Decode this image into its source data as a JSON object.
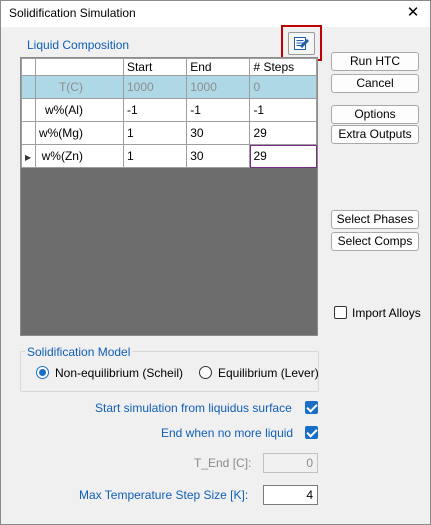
{
  "window": {
    "title": "Solidification Simulation",
    "close_label": "✕"
  },
  "liquid_composition": {
    "label": "Liquid Composition",
    "columns": [
      "",
      "Start",
      "End",
      "# Steps"
    ],
    "rows": [
      {
        "name": "T(C)",
        "start": "1000",
        "end": "1000",
        "steps": "0",
        "disabled": true
      },
      {
        "name": "w%(Al)",
        "start": "-1",
        "end": "-1",
        "steps": "-1"
      },
      {
        "name": "w%(Mg)",
        "start": "1",
        "end": "30",
        "steps": "29"
      },
      {
        "name": "w%(Zn)",
        "start": "1",
        "end": "30",
        "steps": "29",
        "current": true
      }
    ]
  },
  "buttons": {
    "run_htc": "Run HTC",
    "cancel": "Cancel",
    "options": "Options",
    "extra_outputs": "Extra Outputs",
    "select_phases": "Select Phases",
    "select_comps": "Select Comps"
  },
  "import_alloys": {
    "label": "Import Alloys",
    "checked": false
  },
  "solidification_model": {
    "label": "Solidification Model",
    "options": [
      {
        "label": "Non-equilibrium (Scheil)",
        "selected": true
      },
      {
        "label": "Equilibrium (Lever)",
        "selected": false
      }
    ]
  },
  "settings": {
    "start_from_liquidus": {
      "label": "Start simulation from liquidus surface",
      "checked": true
    },
    "end_no_liquid": {
      "label": "End when no more liquid",
      "checked": true
    },
    "t_end": {
      "label": "T_End [C]:",
      "value": "0",
      "disabled": true
    },
    "max_temp_step": {
      "label": "Max Temperature Step Size [K]:",
      "value": "4"
    }
  },
  "icons": {
    "export": "export-table-icon",
    "row_indicator": "row-pointer-icon"
  },
  "colors": {
    "accent": "#0f5fb8",
    "highlight_row": "#aed8e6",
    "checkbox": "#1a6ec5",
    "callout": "#c00000"
  }
}
